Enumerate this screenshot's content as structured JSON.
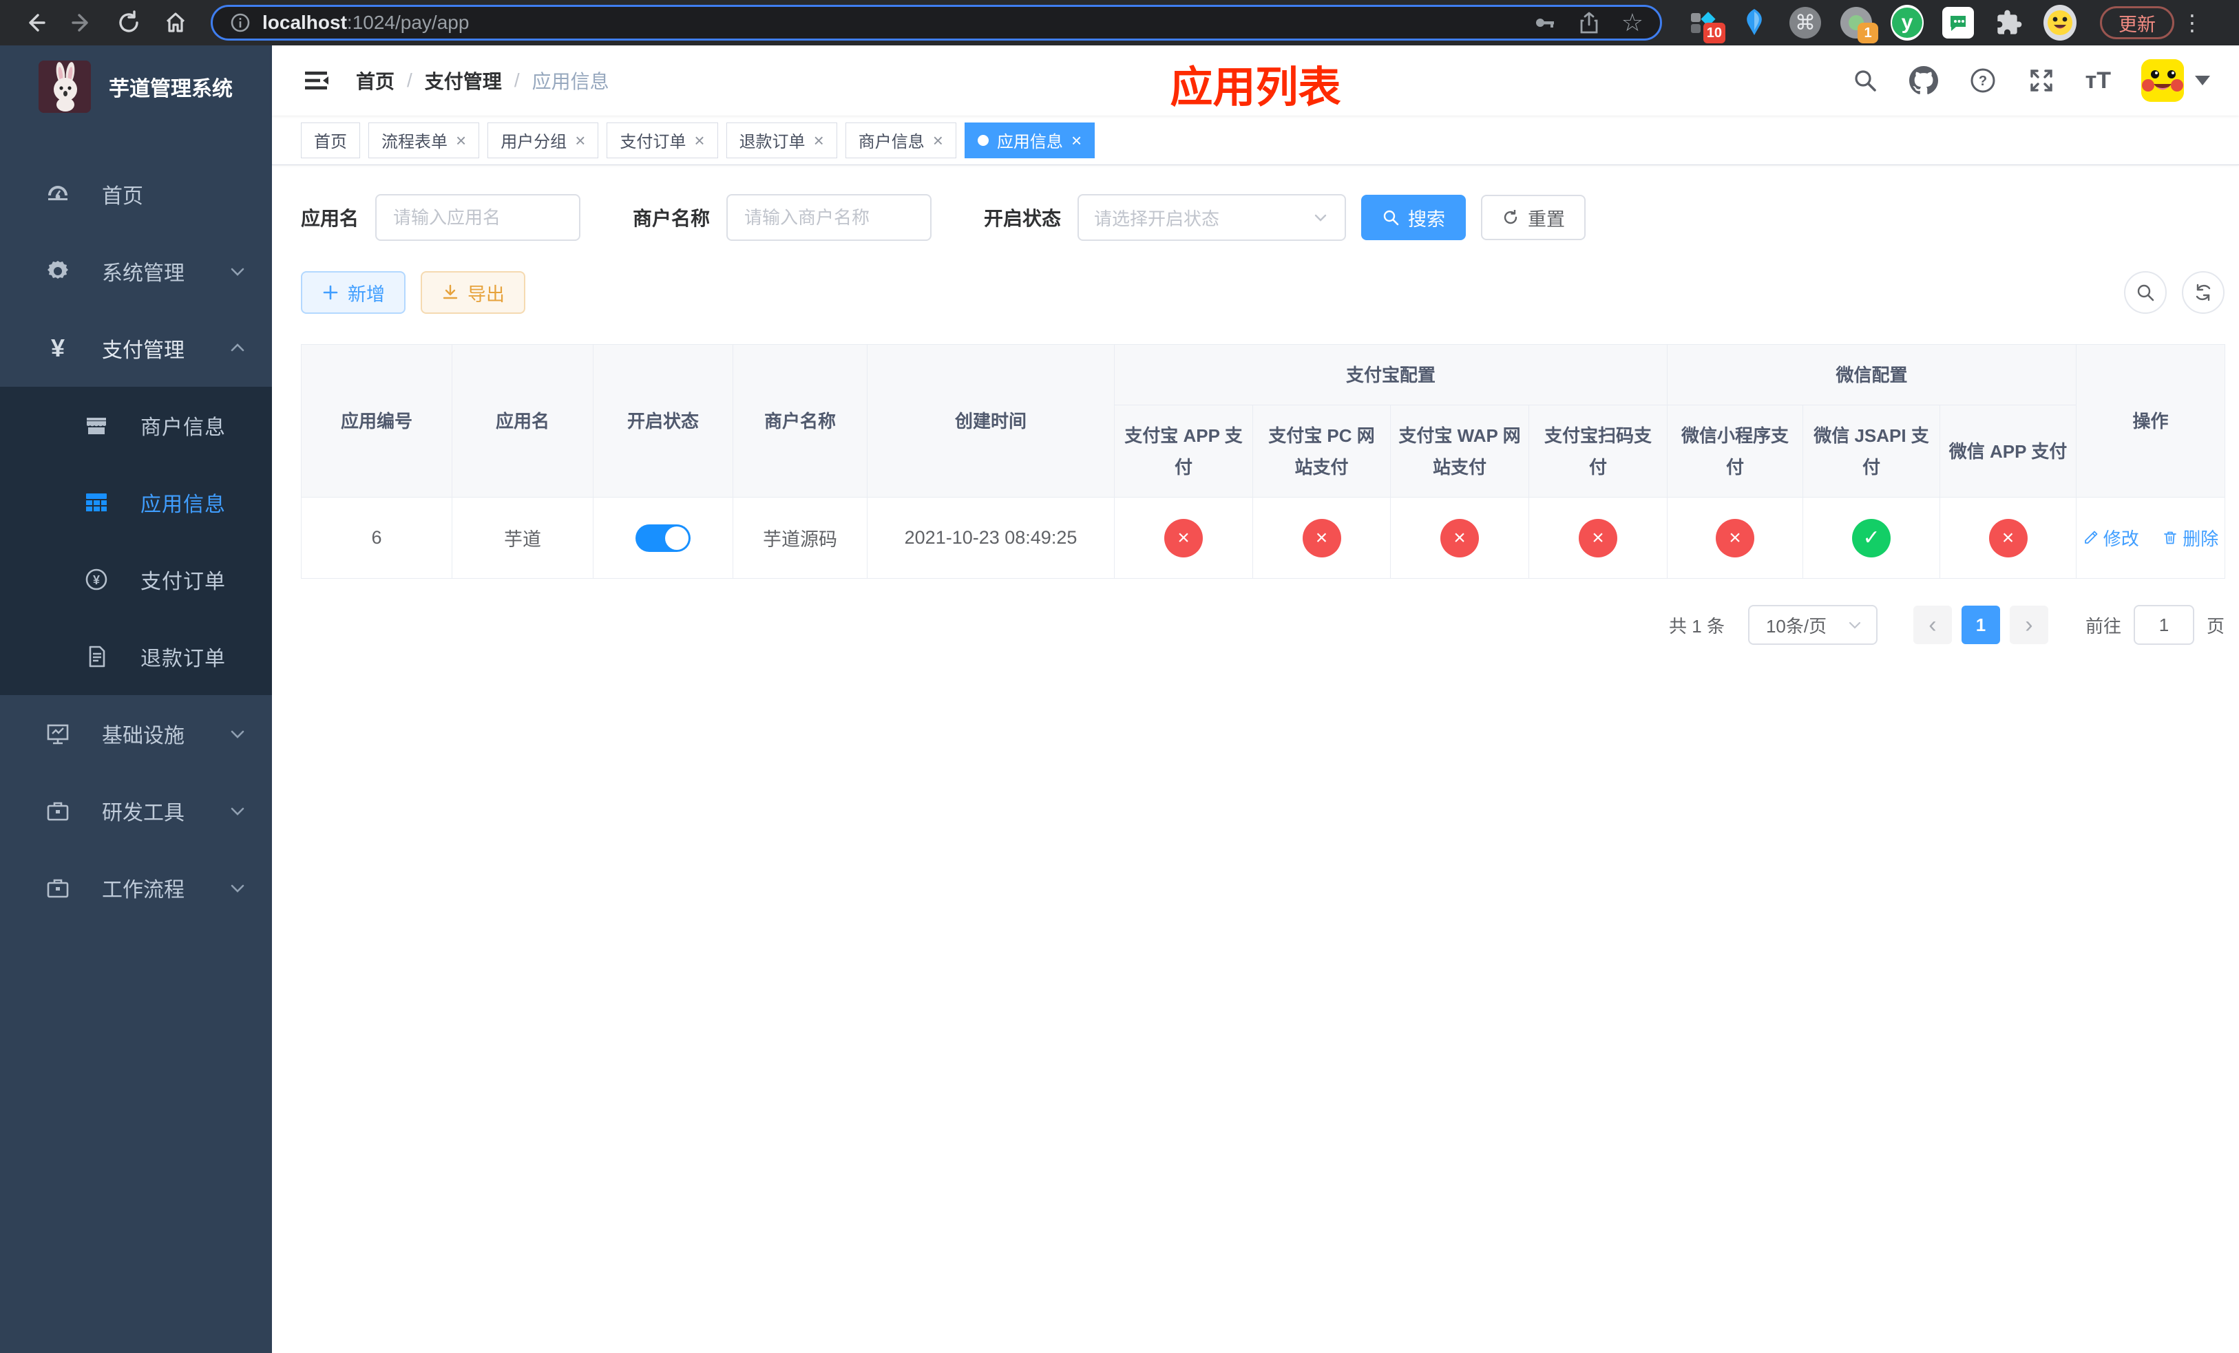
{
  "browser": {
    "url_host": "localhost",
    "url_rest": ":1024/pay/app",
    "update_label": "更新",
    "ext_badge_blue": "10",
    "ext_badge_record": "1",
    "ext_y_letter": "y"
  },
  "icons": {
    "close": "×",
    "separator": "/",
    "prev": "‹",
    "next": "›",
    "command": "⌘",
    "kebab": "⋮",
    "star": "☆",
    "yen": "¥",
    "font_size": "тT"
  },
  "sidebar": {
    "title": "芋道管理系统",
    "home": "首页",
    "system": "系统管理",
    "pay": "支付管理",
    "sub_merchant": "商户信息",
    "sub_app": "应用信息",
    "sub_order": "支付订单",
    "sub_refund": "退款订单",
    "infra": "基础设施",
    "devtool": "研发工具",
    "workflow": "工作流程"
  },
  "breadcrumb": {
    "home": "首页",
    "section": "支付管理",
    "current": "应用信息"
  },
  "page": {
    "overlay_title": "应用列表"
  },
  "tabs": [
    {
      "label": "首页",
      "closable": false,
      "active": false
    },
    {
      "label": "流程表单",
      "closable": true,
      "active": false
    },
    {
      "label": "用户分组",
      "closable": true,
      "active": false
    },
    {
      "label": "支付订单",
      "closable": true,
      "active": false
    },
    {
      "label": "退款订单",
      "closable": true,
      "active": false
    },
    {
      "label": "商户信息",
      "closable": true,
      "active": false
    },
    {
      "label": "应用信息",
      "closable": true,
      "active": true
    }
  ],
  "filters": {
    "name_label": "应用名",
    "name_placeholder": "请输入应用名",
    "merchant_label": "商户名称",
    "merchant_placeholder": "请输入商户名称",
    "status_label": "开启状态",
    "status_placeholder": "请选择开启状态",
    "search_label": "搜索",
    "reset_label": "重置"
  },
  "toolbar": {
    "add": "新增",
    "export": "导出"
  },
  "table": {
    "headers": {
      "app_id": "应用编号",
      "app_name": "应用名",
      "open_status": "开启状态",
      "merchant_name": "商户名称",
      "create_time": "创建时间",
      "alipay_group": "支付宝配置",
      "wechat_group": "微信配置",
      "alipay_app": "支付宝 APP 支付",
      "alipay_pc": "支付宝 PC 网站支付",
      "alipay_wap": "支付宝 WAP 网站支付",
      "alipay_qr": "支付宝扫码支付",
      "wx_mini": "微信小程序支付",
      "wx_jsapi": "微信 JSAPI 支付",
      "wx_app": "微信 APP 支付",
      "ops": "操作"
    },
    "row": {
      "app_id": "6",
      "app_name": "芋道",
      "open": true,
      "merchant_name": "芋道源码",
      "create_time": "2021-10-23 08:49:25",
      "statuses": [
        "no",
        "no",
        "no",
        "no",
        "no",
        "yes",
        "no"
      ],
      "edit": "修改",
      "delete": "删除"
    }
  },
  "pagination": {
    "total": "共 1 条",
    "page_size": "10条/页",
    "page": "1",
    "goto": "前往",
    "goto_value": "1",
    "unit": "页"
  },
  "colors": {
    "accent": "#409eff",
    "switch_on": "#1890ff",
    "danger": "#f45151",
    "success": "#13ce66",
    "title_red": "#fe2a00",
    "sidebar_bg": "#304156",
    "submenu_bg": "#1f2d3d"
  }
}
